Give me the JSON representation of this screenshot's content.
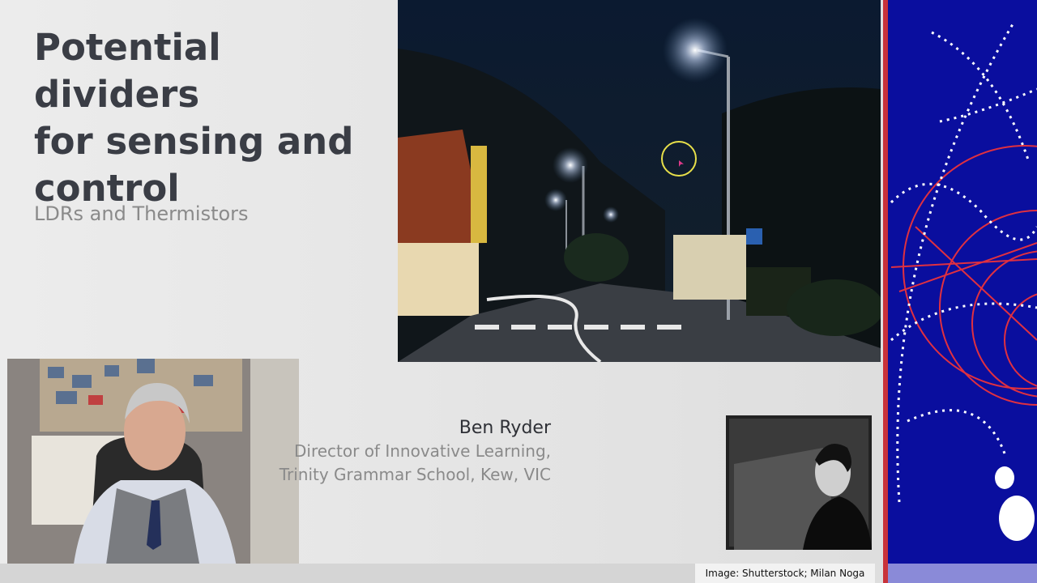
{
  "slide": {
    "title": "Potential dividers\nfor sensing and\ncontrol",
    "subtitle": "LDRs and Thermistors"
  },
  "credit": {
    "name": "Ben Ryder",
    "role": "Director of Innovative Learning,",
    "org": "Trinity Grammar School, Kew, VIC"
  },
  "photo_caption": "Image: Shutterstock; Milan Noga",
  "colors": {
    "title": "#3a3d45",
    "subtitle": "#8a8a8a",
    "particle_bg": "#0a0e9e",
    "particle_track": "#e03040",
    "divider": "#c8323a"
  }
}
